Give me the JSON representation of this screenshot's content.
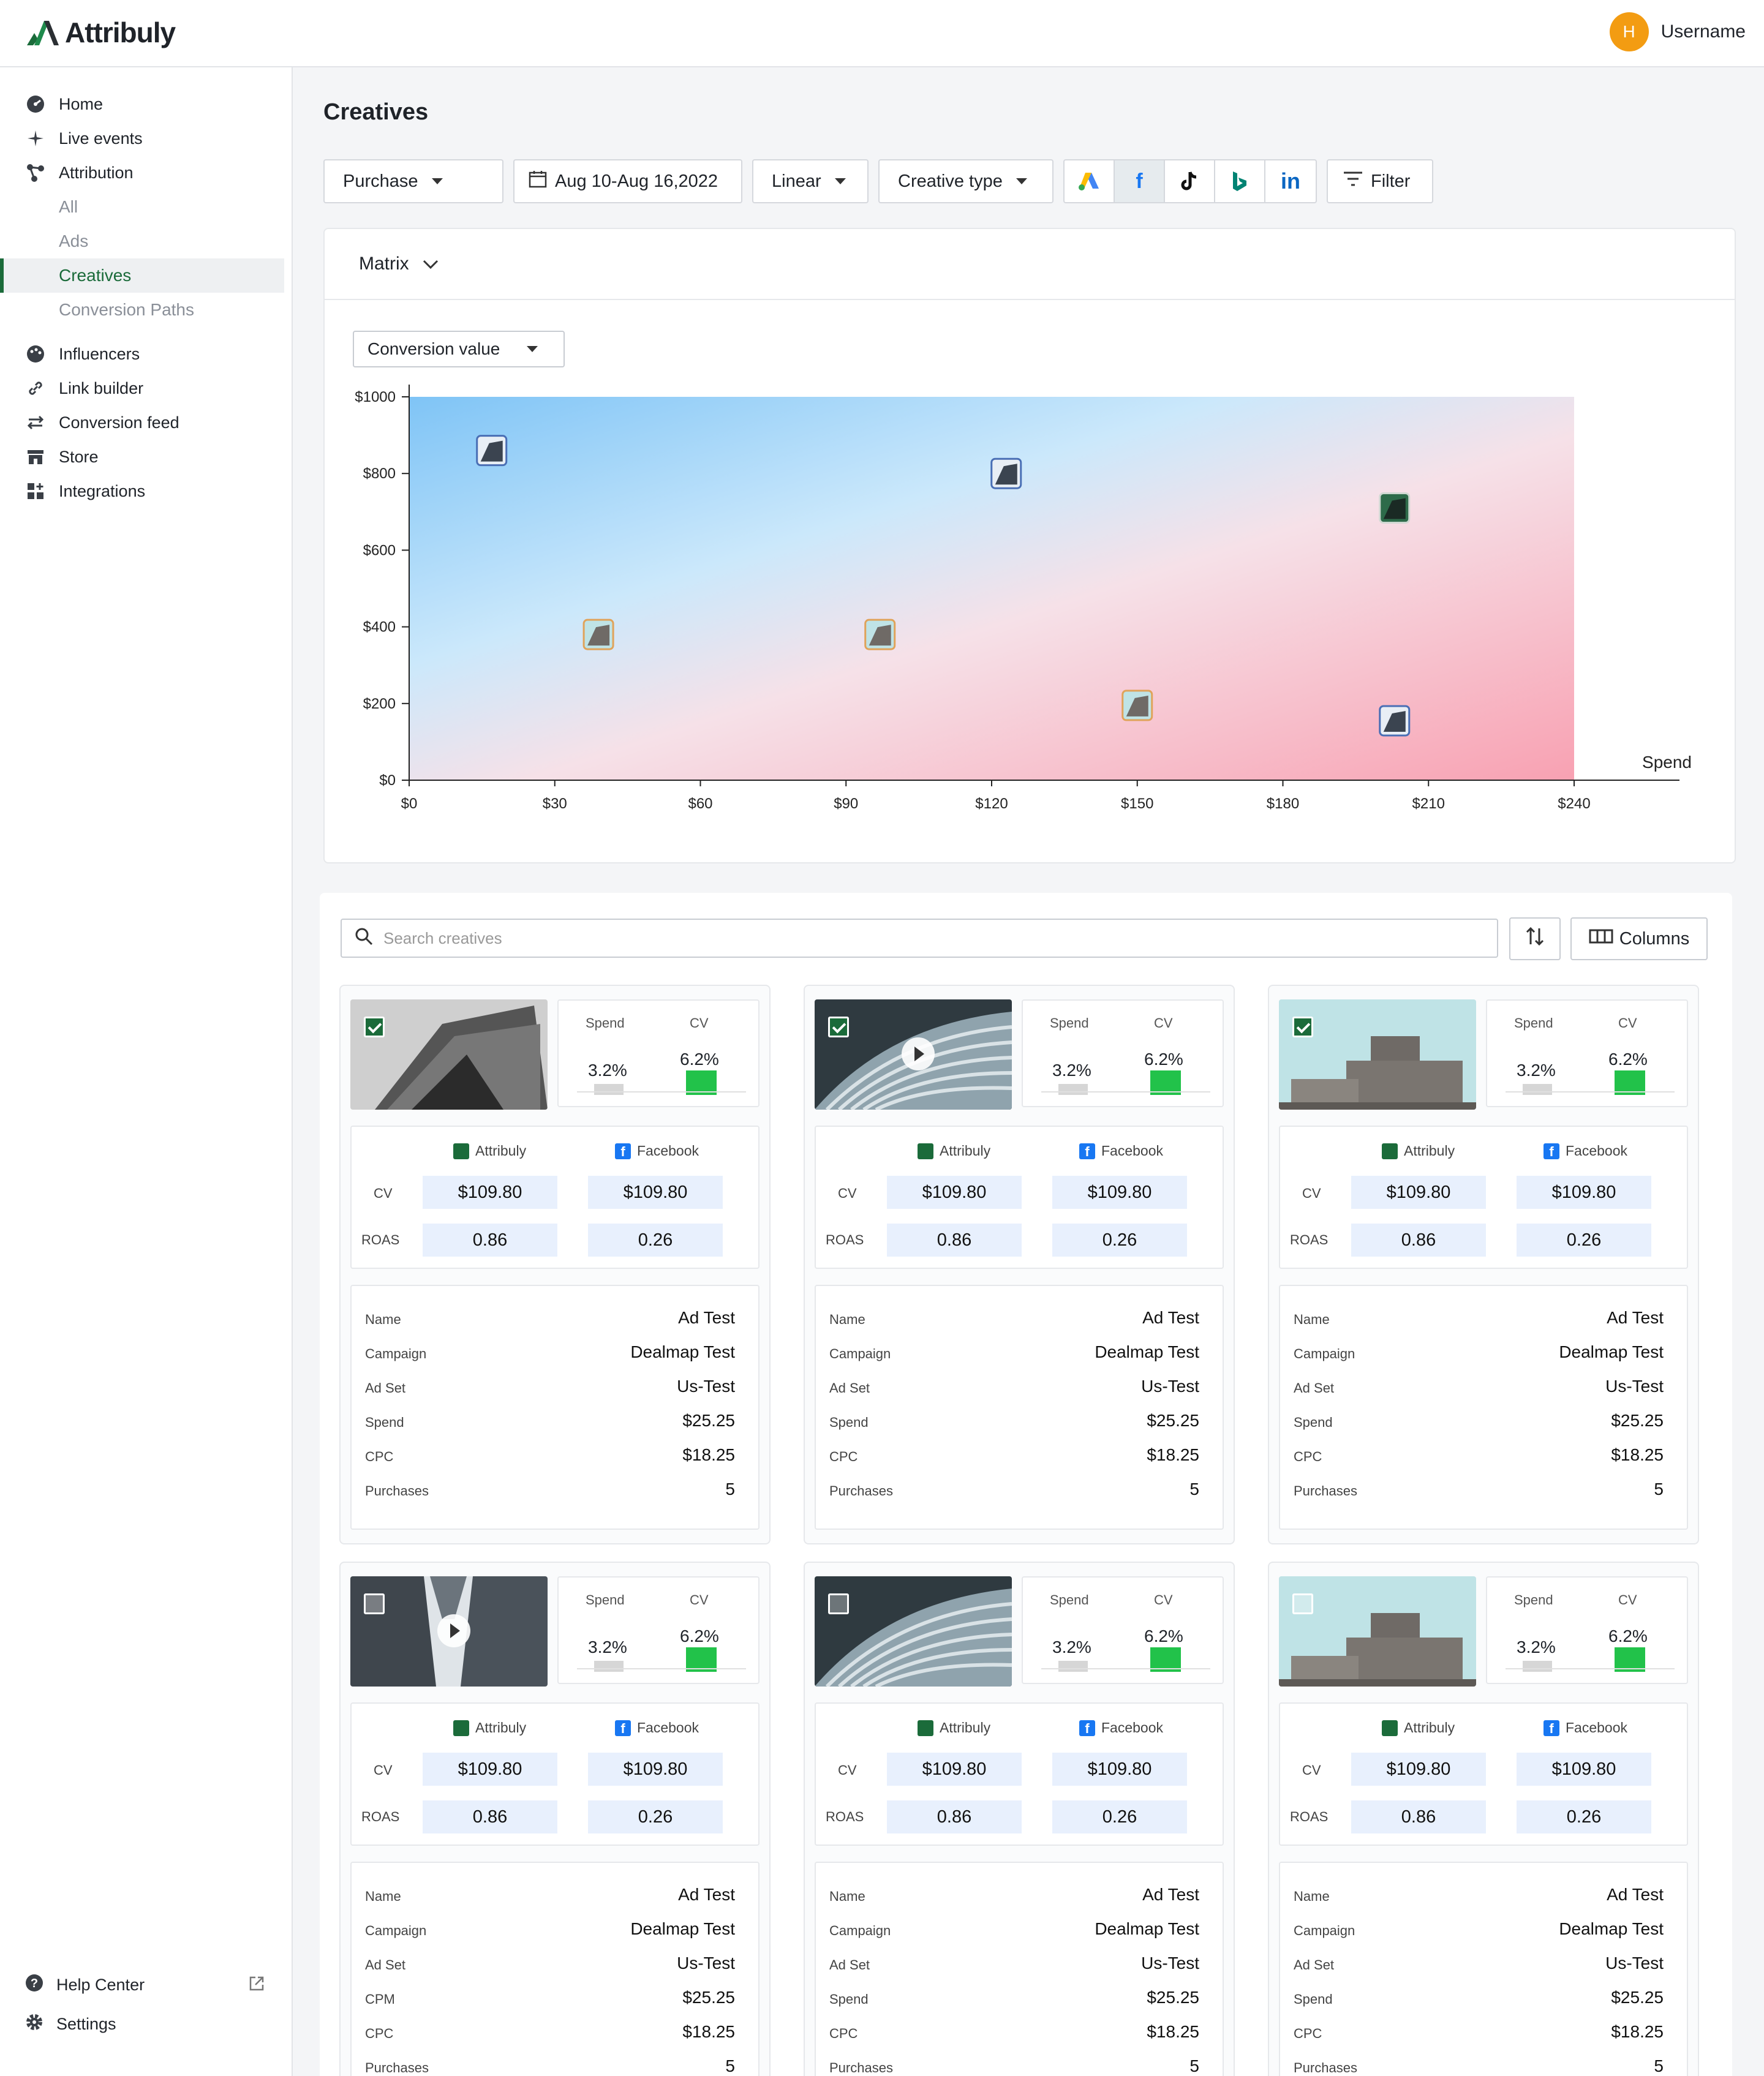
{
  "app": {
    "name": "Attribuly",
    "username": "Username",
    "avatar_initial": "H"
  },
  "sidebar": {
    "items": [
      {
        "label": "Home",
        "icon": "dashboard-icon"
      },
      {
        "label": "Live events",
        "icon": "sparkle-icon"
      },
      {
        "label": "Attribution",
        "icon": "branch-icon"
      }
    ],
    "sub_items": [
      "All",
      "Ads",
      "Creatives",
      "Conversion Paths"
    ],
    "items2": [
      {
        "label": "Influencers",
        "icon": "palette-icon"
      },
      {
        "label": "Link builder",
        "icon": "link-icon"
      },
      {
        "label": "Conversion feed",
        "icon": "swap-icon"
      },
      {
        "label": "Store",
        "icon": "store-icon"
      },
      {
        "label": "Integrations",
        "icon": "grid-plus-icon"
      }
    ],
    "help": "Help Center",
    "settings": "Settings"
  },
  "page": {
    "title": "Creatives"
  },
  "toolbar": {
    "event": "Purchase",
    "date_range": "Aug 10-Aug 16,2022",
    "model": "Linear",
    "creative_type": "Creative type",
    "filter": "Filter",
    "platforms": [
      {
        "name": "google-ads-icon",
        "color": "#4285f4"
      },
      {
        "name": "facebook-icon",
        "color": "#1877f2"
      },
      {
        "name": "tiktok-icon",
        "color": "#000000"
      },
      {
        "name": "bing-icon",
        "color": "#008373"
      },
      {
        "name": "linkedin-icon",
        "color": "#0a66c2"
      }
    ]
  },
  "matrix": {
    "view": "Matrix",
    "metric": "Conversion value"
  },
  "chart_data": {
    "type": "scatter",
    "xlabel": "Spend",
    "x_ticks": [
      "$0",
      "$30",
      "$60",
      "$90",
      "$120",
      "$150",
      "$180",
      "$210",
      "$240"
    ],
    "y_ticks": [
      "$0",
      "$200",
      "$400",
      "$600",
      "$800",
      "$1000"
    ],
    "xlim": [
      0,
      240
    ],
    "ylim": [
      0,
      1000
    ],
    "points": [
      {
        "x": 17,
        "y": 860,
        "thumb": "dark"
      },
      {
        "x": 39,
        "y": 380,
        "thumb": "building"
      },
      {
        "x": 97,
        "y": 380,
        "thumb": "building"
      },
      {
        "x": 123,
        "y": 800,
        "thumb": "dark"
      },
      {
        "x": 150,
        "y": 195,
        "thumb": "building"
      },
      {
        "x": 203,
        "y": 710,
        "thumb": "green"
      },
      {
        "x": 203,
        "y": 155,
        "thumb": "dark"
      }
    ]
  },
  "grid": {
    "search_placeholder": "Search creatives",
    "columns_label": "Columns"
  },
  "colors": {
    "accent": "#1b6b3a",
    "positive_bar": "#22c24a",
    "value_bg": "#e8f0fd"
  },
  "cards": [
    {
      "thumb": "arch",
      "checked": true,
      "video": false,
      "spend_label": "Spend",
      "cv_label": "CV",
      "spend": "3.2%",
      "cv": "6.2%",
      "attribuly": "Attribuly",
      "facebook": "Facebook",
      "cv_row": "CV",
      "roas_row": "ROAS",
      "cv_a": "$109.80",
      "cv_f": "$109.80",
      "roas_a": "0.86",
      "roas_f": "0.26",
      "rows": [
        [
          "Name",
          "Ad Test"
        ],
        [
          "Campaign",
          "Dealmap Test"
        ],
        [
          "Ad Set",
          "Us-Test"
        ],
        [
          "Spend",
          "$25.25"
        ],
        [
          "CPC",
          "$18.25"
        ],
        [
          "Purchases",
          "5"
        ]
      ]
    },
    {
      "thumb": "wave",
      "checked": true,
      "video": true,
      "spend_label": "Spend",
      "cv_label": "CV",
      "spend": "3.2%",
      "cv": "6.2%",
      "attribuly": "Attribuly",
      "facebook": "Facebook",
      "cv_row": "CV",
      "roas_row": "ROAS",
      "cv_a": "$109.80",
      "cv_f": "$109.80",
      "roas_a": "0.86",
      "roas_f": "0.26",
      "rows": [
        [
          "Name",
          "Ad Test"
        ],
        [
          "Campaign",
          "Dealmap Test"
        ],
        [
          "Ad Set",
          "Us-Test"
        ],
        [
          "Spend",
          "$25.25"
        ],
        [
          "CPC",
          "$18.25"
        ],
        [
          "Purchases",
          "5"
        ]
      ]
    },
    {
      "thumb": "building",
      "checked": true,
      "video": false,
      "spend_label": "Spend",
      "cv_label": "CV",
      "spend": "3.2%",
      "cv": "6.2%",
      "attribuly": "Attribuly",
      "facebook": "Facebook",
      "cv_row": "CV",
      "roas_row": "ROAS",
      "cv_a": "$109.80",
      "cv_f": "$109.80",
      "roas_a": "0.86",
      "roas_f": "0.26",
      "rows": [
        [
          "Name",
          "Ad Test"
        ],
        [
          "Campaign",
          "Dealmap Test"
        ],
        [
          "Ad Set",
          "Us-Test"
        ],
        [
          "Spend",
          "$25.25"
        ],
        [
          "CPC",
          "$18.25"
        ],
        [
          "Purchases",
          "5"
        ]
      ]
    },
    {
      "thumb": "towers",
      "checked": false,
      "video": true,
      "spend_label": "Spend",
      "cv_label": "CV",
      "spend": "3.2%",
      "cv": "6.2%",
      "attribuly": "Attribuly",
      "facebook": "Facebook",
      "cv_row": "CV",
      "roas_row": "ROAS",
      "cv_a": "$109.80",
      "cv_f": "$109.80",
      "roas_a": "0.86",
      "roas_f": "0.26",
      "rows": [
        [
          "Name",
          "Ad Test"
        ],
        [
          "Campaign",
          "Dealmap Test"
        ],
        [
          "Ad Set",
          "Us-Test"
        ],
        [
          "CPM",
          "$25.25"
        ],
        [
          "CPC",
          "$18.25"
        ],
        [
          "Purchases",
          "5"
        ]
      ]
    },
    {
      "thumb": "wave",
      "checked": false,
      "video": false,
      "spend_label": "Spend",
      "cv_label": "CV",
      "spend": "3.2%",
      "cv": "6.2%",
      "attribuly": "Attribuly",
      "facebook": "Facebook",
      "cv_row": "CV",
      "roas_row": "ROAS",
      "cv_a": "$109.80",
      "cv_f": "$109.80",
      "roas_a": "0.86",
      "roas_f": "0.26",
      "rows": [
        [
          "Name",
          "Ad Test"
        ],
        [
          "Campaign",
          "Dealmap Test"
        ],
        [
          "Ad Set",
          "Us-Test"
        ],
        [
          "Spend",
          "$25.25"
        ],
        [
          "CPC",
          "$18.25"
        ],
        [
          "Purchases",
          "5"
        ]
      ]
    },
    {
      "thumb": "building",
      "checked": false,
      "video": false,
      "spend_label": "Spend",
      "cv_label": "CV",
      "spend": "3.2%",
      "cv": "6.2%",
      "attribuly": "Attribuly",
      "facebook": "Facebook",
      "cv_row": "CV",
      "roas_row": "ROAS",
      "cv_a": "$109.80",
      "cv_f": "$109.80",
      "roas_a": "0.86",
      "roas_f": "0.26",
      "rows": [
        [
          "Name",
          "Ad Test"
        ],
        [
          "Campaign",
          "Dealmap Test"
        ],
        [
          "Ad Set",
          "Us-Test"
        ],
        [
          "Spend",
          "$25.25"
        ],
        [
          "CPC",
          "$18.25"
        ],
        [
          "Purchases",
          "5"
        ]
      ]
    }
  ]
}
